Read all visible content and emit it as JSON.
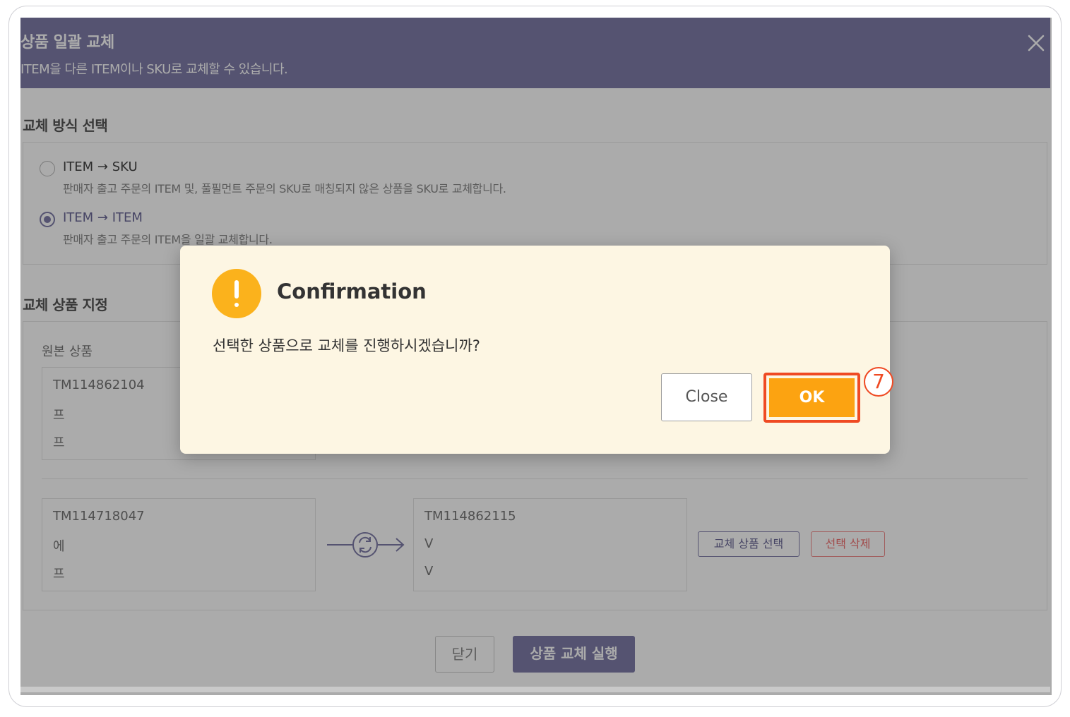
{
  "header": {
    "title": "상품 일괄 교체",
    "subtitle": "ITEM을 다른 ITEM이나 SKU로 교체할 수 있습니다.",
    "close_icon": "close-x-icon"
  },
  "method_section": {
    "title": "교체 방식 선택",
    "options": [
      {
        "label": "ITEM → SKU",
        "description": "판매자 출고 주문의 ITEM 및, 풀필먼트 주문의 SKU로 매칭되지 않은 상품을 SKU로 교체합니다.",
        "selected": false
      },
      {
        "label": "ITEM → ITEM",
        "description": "판매자 출고 주문의 ITEM을 일괄 교체합니다.",
        "selected": true
      }
    ]
  },
  "target_section": {
    "title": "교체 상품 지정",
    "source_label": "원본 상품",
    "row1": {
      "source": {
        "code": "TM114862104",
        "line2": "프",
        "line3": "프"
      }
    },
    "row2": {
      "source": {
        "code": "TM114718047",
        "line2": "에",
        "line3": "프"
      },
      "target": {
        "code": "TM114862115",
        "line2": "V",
        "line3": "V"
      },
      "select_button": "교체 상품 선택",
      "delete_button": "선택 삭제"
    }
  },
  "footer": {
    "close_button": "닫기",
    "run_button": "상품 교체 실행"
  },
  "dialog": {
    "title": "Confirmation",
    "message": "선택한 상품으로 교체를 진행하시겠습니까?",
    "close_button": "Close",
    "ok_button": "OK",
    "step_marker": "7",
    "accent_color": "#fca311",
    "highlight_color": "#ef4a23"
  },
  "colors": {
    "header": "#7f7da9",
    "dialog_bg": "#fdf6e3"
  }
}
